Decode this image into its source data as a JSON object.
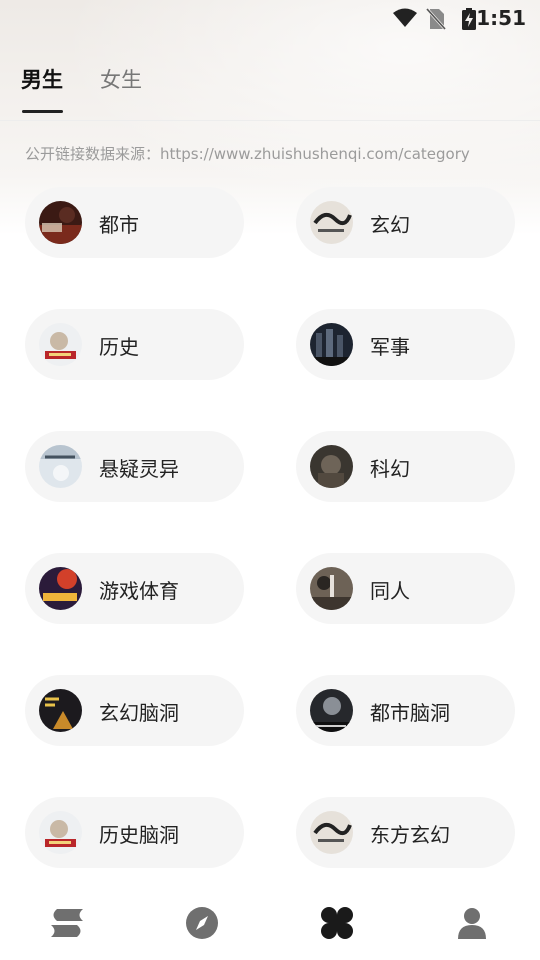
{
  "status_bar": {
    "time": "1:51"
  },
  "tabs": [
    {
      "label": "男生",
      "active": true
    },
    {
      "label": "女生",
      "active": false
    }
  ],
  "source_note": "公开链接数据来源：https://www.zhuishushenqi.com/category",
  "categories": [
    {
      "label": "都市",
      "cover": "cover-dushi"
    },
    {
      "label": "玄幻",
      "cover": "cover-xuanhuan"
    },
    {
      "label": "历史",
      "cover": "cover-lishi"
    },
    {
      "label": "军事",
      "cover": "cover-junshi"
    },
    {
      "label": "悬疑灵异",
      "cover": "cover-xuanyi"
    },
    {
      "label": "科幻",
      "cover": "cover-kehuan"
    },
    {
      "label": "游戏体育",
      "cover": "cover-youxi"
    },
    {
      "label": "同人",
      "cover": "cover-tongren"
    },
    {
      "label": "玄幻脑洞",
      "cover": "cover-xuanhuan-naodong"
    },
    {
      "label": "都市脑洞",
      "cover": "cover-dushi-naodong"
    },
    {
      "label": "历史脑洞",
      "cover": "cover-lishi-naodong"
    },
    {
      "label": "东方玄幻",
      "cover": "cover-dongfang"
    }
  ],
  "bottom_nav": [
    {
      "name": "bookshelf",
      "icon": "stack-icon",
      "active": false
    },
    {
      "name": "discover",
      "icon": "compass-icon",
      "active": false
    },
    {
      "name": "category",
      "icon": "clover-grid-icon",
      "active": true
    },
    {
      "name": "profile",
      "icon": "person-icon",
      "active": false
    }
  ],
  "colors": {
    "pill_bg": "#f5f5f5",
    "text_primary": "#222222",
    "text_muted": "#9b9b9b",
    "nav_active": "#1a1a1a",
    "nav_inactive": "#777777"
  }
}
